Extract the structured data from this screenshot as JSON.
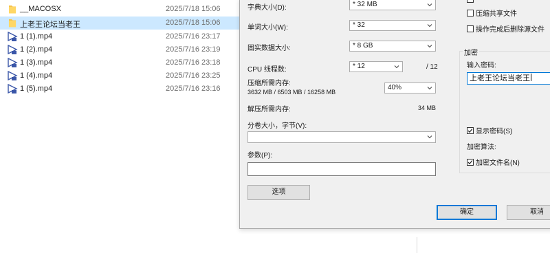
{
  "file_list": {
    "rows": [
      {
        "name": "__MACOSX",
        "date": "2025/7/18 15:06",
        "icon": "folder-icon"
      },
      {
        "name": "上老王论坛当老王",
        "date": "2025/7/18 15:06",
        "icon": "folder-icon",
        "selected": true
      },
      {
        "name": "1 (1).mp4",
        "date": "2025/7/16 23:17",
        "icon": "video-file-icon"
      },
      {
        "name": "1 (2).mp4",
        "date": "2025/7/16 23:19",
        "icon": "video-file-icon"
      },
      {
        "name": "1 (3).mp4",
        "date": "2025/7/16 23:18",
        "icon": "video-file-icon"
      },
      {
        "name": "1 (4).mp4",
        "date": "2025/7/16 23:25",
        "icon": "video-file-icon"
      },
      {
        "name": "1 (5).mp4",
        "date": "2025/7/16 23:16",
        "icon": "video-file-icon"
      }
    ]
  },
  "dialog": {
    "dict_size": {
      "label": "字典大小(D):",
      "value": "* 32 MB"
    },
    "word_size": {
      "label": "单词大小(W):",
      "value": "* 32"
    },
    "solid_block": {
      "label": "固实数据大小:",
      "value": "* 8 GB"
    },
    "cpu_threads": {
      "label": "CPU 线程数:",
      "value": "* 12",
      "max": "/ 12"
    },
    "compress_memory": {
      "label": "压缩所需内存:",
      "detail": "3632 MB / 6503 MB / 16258 MB",
      "value": "40%"
    },
    "decompress_memory": {
      "label": "解压所需内存:",
      "value": "34 MB"
    },
    "split_volume": {
      "label": "分卷大小，字节(V):",
      "value": ""
    },
    "parameters": {
      "label": "参数(P):",
      "value": ""
    },
    "options_button": "选项",
    "ok_button": "确定",
    "cancel_button": "取消",
    "compress_shared": {
      "label": "压缩共享文件",
      "checked": false
    },
    "delete_after": {
      "label": "操作完成后删除源文件",
      "checked": false
    },
    "encryption": {
      "title": "加密",
      "password_label": "输入密码:",
      "password_value": "上老王论坛当老王",
      "show_password": {
        "label": "显示密码(S)",
        "checked": true
      },
      "method_label": "加密算法:",
      "encrypt_names": {
        "label": "加密文件名(N)",
        "checked": true
      }
    }
  },
  "colors": {
    "selection": "#cce8ff",
    "accent": "#0078d7",
    "dialog_bg": "#f0f0f0"
  }
}
